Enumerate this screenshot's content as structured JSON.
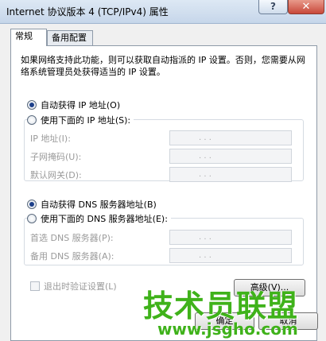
{
  "window": {
    "title": "Internet 协议版本 4 (TCP/IPv4) 属性",
    "help_label": "?",
    "close_label": "✕"
  },
  "tabs": [
    {
      "label": "常规",
      "active": true
    },
    {
      "label": "备用配置",
      "active": false
    }
  ],
  "description": "如果网络支持此功能，则可以获取自动指派的 IP 设置。否则，您需要从网络系统管理员处获得适当的 IP 设置。",
  "ip_section": {
    "auto_label": "自动获得 IP 地址(O)",
    "auto_checked": true,
    "manual_label": "使用下面的 IP 地址(S):",
    "manual_checked": false,
    "fields": [
      {
        "label": "IP 地址(I):",
        "value": ". . ."
      },
      {
        "label": "子网掩码(U):",
        "value": ". . ."
      },
      {
        "label": "默认网关(D):",
        "value": ". . ."
      }
    ]
  },
  "dns_section": {
    "auto_label": "自动获得 DNS 服务器地址(B)",
    "auto_checked": true,
    "manual_label": "使用下面的 DNS 服务器地址(E):",
    "manual_checked": false,
    "fields": [
      {
        "label": "首选 DNS 服务器(P):",
        "value": ". . ."
      },
      {
        "label": "备用 DNS 服务器(A):",
        "value": ". . ."
      }
    ]
  },
  "validate_label": "退出时验证设置(L)",
  "buttons": {
    "advanced": "高级(V)...",
    "ok": "确定",
    "cancel": "取消"
  },
  "watermark": {
    "text": "技术员联盟",
    "url": "www.jsgho.com"
  },
  "colors": {
    "watermark": "#3fb21a",
    "titlebar": "#c6d6ea",
    "close_button": "#c8483a"
  }
}
